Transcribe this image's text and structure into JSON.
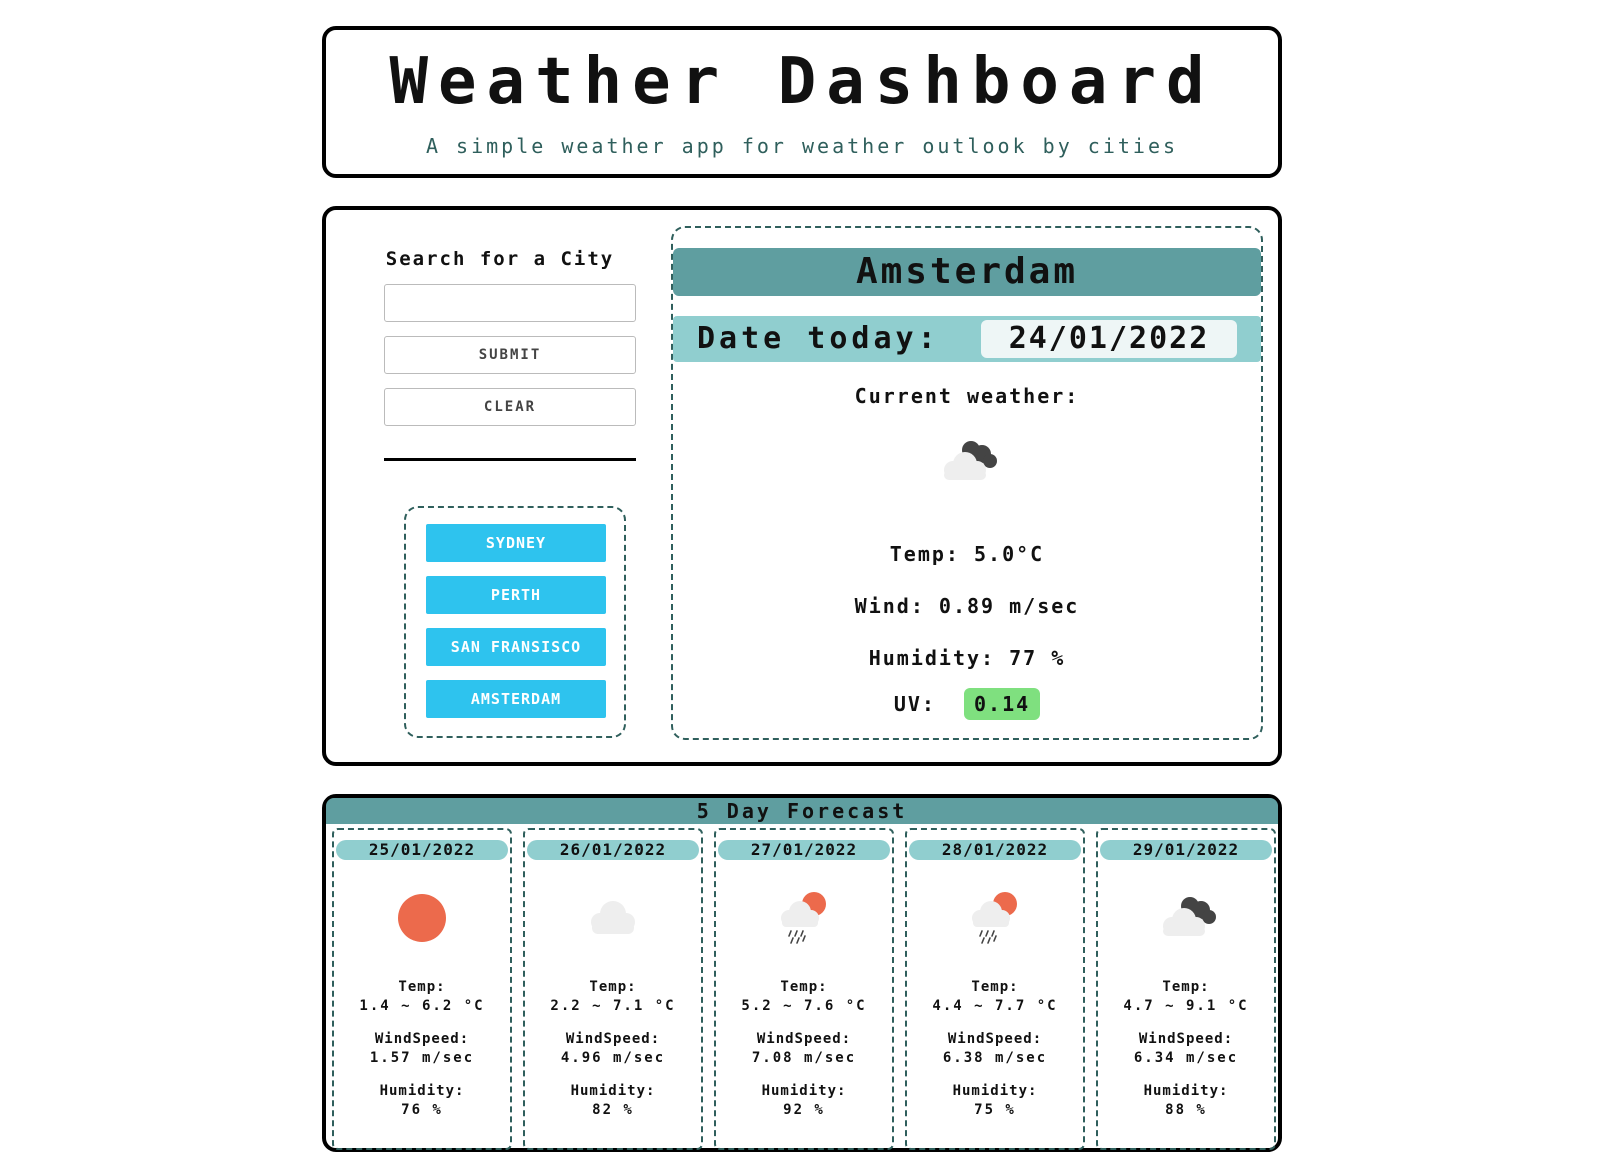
{
  "header": {
    "title": "Weather Dashboard",
    "subtitle": "A simple weather app for weather outlook by cities"
  },
  "search": {
    "label": "Search for a City",
    "input_value": "",
    "submit_label": "SUBMIT",
    "clear_label": "CLEAR"
  },
  "history": [
    {
      "label": "SYDNEY"
    },
    {
      "label": "PERTH"
    },
    {
      "label": "SAN FRANSISCO"
    },
    {
      "label": "AMSTERDAM"
    }
  ],
  "current": {
    "city": "Amsterdam",
    "date_label": "Date today:",
    "date": "24/01/2022",
    "heading": "Current weather:",
    "icon": "dark-clouds-icon",
    "temp_label": "Temp:",
    "temp": "5.0°C",
    "wind_label": "Wind:",
    "wind": "0.89 m/sec",
    "humidity_label": "Humidity:",
    "humidity": "77 %",
    "uv_label": "UV:",
    "uv": "0.14",
    "uv_color": "#7fe07f"
  },
  "forecast": {
    "heading": "5 Day Forecast",
    "temp_label": "Temp:",
    "wind_label": "WindSpeed:",
    "humidity_label": "Humidity:",
    "days": [
      {
        "date": "25/01/2022",
        "icon": "sun-icon",
        "temp": "1.4 ~ 6.2 °C",
        "wind": "1.57 m/sec",
        "humidity": "76 %"
      },
      {
        "date": "26/01/2022",
        "icon": "cloud-icon",
        "temp": "2.2 ~ 7.1 °C",
        "wind": "4.96 m/sec",
        "humidity": "82 %"
      },
      {
        "date": "27/01/2022",
        "icon": "rain-sun-icon",
        "temp": "5.2 ~ 7.6 °C",
        "wind": "7.08 m/sec",
        "humidity": "92 %"
      },
      {
        "date": "28/01/2022",
        "icon": "rain-sun-icon",
        "temp": "4.4 ~ 7.7 °C",
        "wind": "6.38 m/sec",
        "humidity": "75 %"
      },
      {
        "date": "29/01/2022",
        "icon": "dark-clouds-icon",
        "temp": "4.7 ~ 9.1 °C",
        "wind": "6.34 m/sec",
        "humidity": "88 %"
      }
    ]
  },
  "colors": {
    "accent_dark": "#5f9ea0",
    "accent_light": "#90cecf",
    "button_blue": "#2ec3ee",
    "sun": "#ec6a4c",
    "cloud": "#eeeeee",
    "dark_cloud": "#444444"
  }
}
